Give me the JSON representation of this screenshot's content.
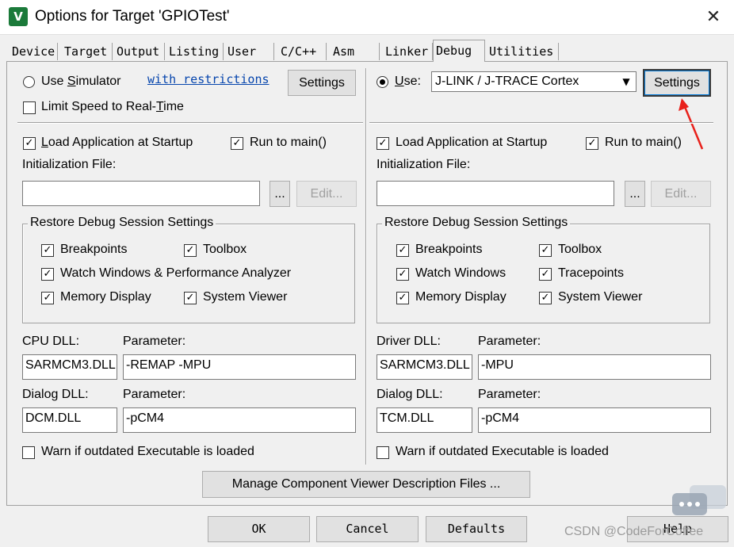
{
  "window": {
    "title": "Options for Target 'GPIOTest'",
    "icon_label": "V",
    "close_glyph": "✕"
  },
  "tabs": [
    "Device",
    "Target",
    "Output",
    "Listing",
    "User",
    "C/C++",
    "Asm",
    "Linker",
    "Debug",
    "Utilities"
  ],
  "active_tab": "Debug",
  "left": {
    "use_simulator": {
      "pre": "Use ",
      "u": "S",
      "post": "imulator"
    },
    "link": "with restrictions",
    "settings": "Settings",
    "limit_speed": {
      "pre": "Limit Speed to Real-",
      "u": "T",
      "post": "ime"
    },
    "load_app": {
      "pre": "",
      "u": "L",
      "post": "oad Application at Startup"
    },
    "run_to_main": {
      "pre": "Run to main()"
    },
    "init_file_label": "Initialization File:",
    "init_file_value": "",
    "browse": "...",
    "edit": "Edit...",
    "restore_title": "Restore Debug Session Settings",
    "restore": [
      {
        "label": "Breakpoints",
        "checked": true
      },
      {
        "label": "Toolbox",
        "checked": true
      },
      {
        "label": "Watch Windows & Performance Analyzer",
        "checked": true
      },
      {
        "label": "Memory Display",
        "checked": true
      },
      {
        "label": "System Viewer",
        "checked": true
      }
    ],
    "dll_label": "CPU DLL:",
    "param_label": "Parameter:",
    "dll_value": "SARMCM3.DLL",
    "param_value": "-REMAP -MPU",
    "dialog_label": "Dialog DLL:",
    "dialog_param_label": "Parameter:",
    "dialog_value": "DCM.DLL",
    "dialog_param_value": "-pCM4",
    "warn": "Warn if outdated Executable is loaded"
  },
  "right": {
    "use": {
      "u": "U",
      "post": "se:"
    },
    "driver": "J-LINK / J-TRACE Cortex",
    "settings": "Settings",
    "load_app": {
      "pre": "Load Application at Startup"
    },
    "run_to_main": {
      "pre": "Run to main()"
    },
    "init_file_label": "Initialization File:",
    "init_file_value": "",
    "browse": "...",
    "edit": "Edit...",
    "restore_title": "Restore Debug Session Settings",
    "restore": [
      {
        "label": "Breakpoints",
        "checked": true
      },
      {
        "label": "Toolbox",
        "checked": true
      },
      {
        "label": "Watch Windows",
        "checked": true
      },
      {
        "label": "Tracepoints",
        "checked": true
      },
      {
        "label": "Memory Display",
        "checked": true
      },
      {
        "label": "System Viewer",
        "checked": true
      }
    ],
    "dll_label": "Driver DLL:",
    "param_label": "Parameter:",
    "dll_value": "SARMCM3.DLL",
    "param_value": "-MPU",
    "dialog_label": "Dialog DLL:",
    "dialog_param_label": "Parameter:",
    "dialog_value": "TCM.DLL",
    "dialog_param_value": "-pCM4",
    "warn": "Warn if outdated Executable is loaded"
  },
  "manage_button": "Manage Component Viewer Description Files ...",
  "footer": {
    "ok": "OK",
    "cancel": "Cancel",
    "defaults": "Defaults",
    "help": "Help"
  },
  "watermark": "CSDN @CodeForCoffee",
  "colors": {
    "annotation_arrow": "#e8211b",
    "link": "#0645ad"
  }
}
